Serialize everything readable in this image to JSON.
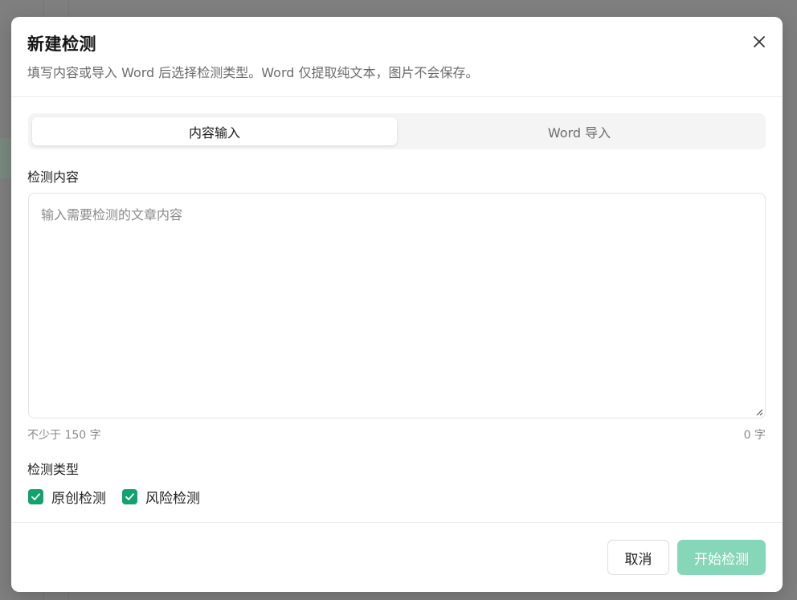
{
  "modal": {
    "title": "新建检测",
    "subtitle": "填写内容或导入 Word 后选择检测类型。Word 仅提取纯文本，图片不会保存。"
  },
  "tabs": [
    {
      "label": "内容输入",
      "active": true
    },
    {
      "label": "Word 导入",
      "active": false
    }
  ],
  "content": {
    "label": "检测内容",
    "placeholder": "输入需要检测的文章内容",
    "value": "",
    "min_hint": "不少于 150 字",
    "count": "0 字"
  },
  "detection_type": {
    "label": "检测类型",
    "options": [
      {
        "label": "原创检测",
        "checked": true
      },
      {
        "label": "风险检测",
        "checked": true
      }
    ]
  },
  "footer": {
    "cancel_label": "取消",
    "start_label": "开始检测"
  },
  "colors": {
    "accent": "#12a26e",
    "start_button_disabled": "#86d6b9",
    "overlay": "#7f7f7f"
  },
  "icons": {
    "close": "close-icon",
    "check": "check-icon",
    "resize": "resize-handle-icon"
  }
}
